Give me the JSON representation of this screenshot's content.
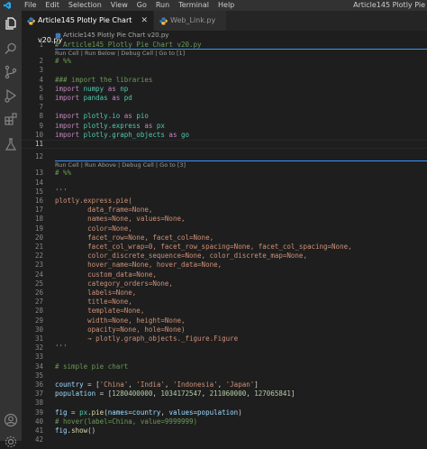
{
  "titlebar": {
    "menu": [
      "File",
      "Edit",
      "Selection",
      "View",
      "Go",
      "Run",
      "Terminal",
      "Help"
    ],
    "window_title": "Article145 Plotly Pie"
  },
  "tabs": [
    {
      "label": "Article145 Plotly Pie Chart v20.py",
      "active": true
    },
    {
      "label": "Web_Link.py",
      "active": false
    }
  ],
  "breadcrumb": "Article145 Plotly Pie Chart v20.py",
  "codelens": {
    "cell1": "Run Cell | Run Below | Debug Cell | Go to [1]",
    "cell3": "Run Cell | Run Above | Debug Cell | Go to [3]"
  },
  "colors": {
    "accent": "#3794ff",
    "comment": "#6a9955",
    "keyword": "#c586c0",
    "string": "#ce9178",
    "number": "#b5cea8"
  },
  "lines": [
    {
      "n": "1",
      "t": [
        [
          "c-com",
          "# Article145 Plotly Pie Chart v20.py"
        ]
      ]
    },
    {
      "n": "2",
      "t": [
        [
          "c-com",
          "# %%"
        ]
      ]
    },
    {
      "n": "3",
      "t": []
    },
    {
      "n": "4",
      "t": [
        [
          "c-com",
          "### import the libraries"
        ]
      ]
    },
    {
      "n": "5",
      "t": [
        [
          "c-kw",
          "import "
        ],
        [
          "c-mod",
          "numpy"
        ],
        [
          "c-kw",
          " as "
        ],
        [
          "c-mod",
          "np"
        ]
      ]
    },
    {
      "n": "6",
      "t": [
        [
          "c-kw",
          "import "
        ],
        [
          "c-mod",
          "pandas"
        ],
        [
          "c-kw",
          " as "
        ],
        [
          "c-mod",
          "pd"
        ]
      ]
    },
    {
      "n": "7",
      "t": []
    },
    {
      "n": "8",
      "t": [
        [
          "c-kw",
          "import "
        ],
        [
          "c-mod",
          "plotly.io"
        ],
        [
          "c-kw",
          " as "
        ],
        [
          "c-mod",
          "pio"
        ]
      ]
    },
    {
      "n": "9",
      "t": [
        [
          "c-kw",
          "import "
        ],
        [
          "c-mod",
          "plotly.express"
        ],
        [
          "c-kw",
          " as "
        ],
        [
          "c-mod",
          "px"
        ]
      ]
    },
    {
      "n": "10",
      "t": [
        [
          "c-kw",
          "import "
        ],
        [
          "c-mod",
          "plotly.graph_objects"
        ],
        [
          "c-kw",
          " as "
        ],
        [
          "c-mod",
          "go"
        ]
      ]
    },
    {
      "n": "11",
      "t": []
    },
    {
      "n": "12",
      "t": []
    },
    {
      "n": "13",
      "t": [
        [
          "c-com",
          "# %%"
        ]
      ]
    },
    {
      "n": "14",
      "t": []
    },
    {
      "n": "15",
      "t": [
        [
          "c-str",
          "'''"
        ]
      ]
    },
    {
      "n": "16",
      "t": [
        [
          "c-str",
          "plotly.express.pie("
        ]
      ]
    },
    {
      "n": "17",
      "t": [
        [
          "c-str",
          "        data_frame=None,"
        ]
      ]
    },
    {
      "n": "18",
      "t": [
        [
          "c-str",
          "        names=None, values=None,"
        ]
      ]
    },
    {
      "n": "19",
      "t": [
        [
          "c-str",
          "        color=None,"
        ]
      ]
    },
    {
      "n": "20",
      "t": [
        [
          "c-str",
          "        facet_row=None, facet_col=None,"
        ]
      ]
    },
    {
      "n": "21",
      "t": [
        [
          "c-str",
          "        facet_col_wrap=0, facet_row_spacing=None, facet_col_spacing=None,"
        ]
      ]
    },
    {
      "n": "22",
      "t": [
        [
          "c-str",
          "        color_discrete_sequence=None, color_discrete_map=None,"
        ]
      ]
    },
    {
      "n": "23",
      "t": [
        [
          "c-str",
          "        hover_name=None, hover_data=None,"
        ]
      ]
    },
    {
      "n": "24",
      "t": [
        [
          "c-str",
          "        custom_data=None,"
        ]
      ]
    },
    {
      "n": "25",
      "t": [
        [
          "c-str",
          "        category_orders=None,"
        ]
      ]
    },
    {
      "n": "26",
      "t": [
        [
          "c-str",
          "        labels=None,"
        ]
      ]
    },
    {
      "n": "27",
      "t": [
        [
          "c-str",
          "        title=None,"
        ]
      ]
    },
    {
      "n": "28",
      "t": [
        [
          "c-str",
          "        template=None,"
        ]
      ]
    },
    {
      "n": "29",
      "t": [
        [
          "c-str",
          "        width=None, height=None,"
        ]
      ]
    },
    {
      "n": "30",
      "t": [
        [
          "c-str",
          "        opacity=None, hole=None)"
        ]
      ]
    },
    {
      "n": "31",
      "t": [
        [
          "c-str",
          "        → plotly.graph_objects._figure.Figure"
        ]
      ]
    },
    {
      "n": "32",
      "t": [
        [
          "c-str",
          "'''"
        ]
      ]
    },
    {
      "n": "33",
      "t": []
    },
    {
      "n": "34",
      "t": [
        [
          "c-com",
          "# simple pie chart"
        ]
      ]
    },
    {
      "n": "35",
      "t": []
    },
    {
      "n": "36",
      "t": [
        [
          "c-id",
          "country"
        ],
        [
          "c-pl",
          " = ["
        ],
        [
          "c-str",
          "'China'"
        ],
        [
          "c-pl",
          ", "
        ],
        [
          "c-str",
          "'India'"
        ],
        [
          "c-pl",
          ", "
        ],
        [
          "c-str",
          "'Indonesia'"
        ],
        [
          "c-pl",
          ", "
        ],
        [
          "c-str",
          "'Japan'"
        ],
        [
          "c-pl",
          "]"
        ]
      ]
    },
    {
      "n": "37",
      "t": [
        [
          "c-id",
          "population"
        ],
        [
          "c-pl",
          " = ["
        ],
        [
          "c-num",
          "1280400000"
        ],
        [
          "c-pl",
          ", "
        ],
        [
          "c-num",
          "1034172547"
        ],
        [
          "c-pl",
          ", "
        ],
        [
          "c-num",
          "211060000"
        ],
        [
          "c-pl",
          ", "
        ],
        [
          "c-num",
          "127065841"
        ],
        [
          "c-pl",
          "]"
        ]
      ]
    },
    {
      "n": "38",
      "t": []
    },
    {
      "n": "39",
      "t": [
        [
          "c-id",
          "fig"
        ],
        [
          "c-pl",
          " = "
        ],
        [
          "c-mod",
          "px"
        ],
        [
          "c-pl",
          "."
        ],
        [
          "c-fn",
          "pie"
        ],
        [
          "c-pl",
          "("
        ],
        [
          "c-id",
          "names"
        ],
        [
          "c-pl",
          "="
        ],
        [
          "c-id",
          "country"
        ],
        [
          "c-pl",
          ", "
        ],
        [
          "c-id",
          "values"
        ],
        [
          "c-pl",
          "="
        ],
        [
          "c-id",
          "population"
        ],
        [
          "c-pl",
          ")"
        ]
      ]
    },
    {
      "n": "40",
      "t": [
        [
          "c-com",
          "# hover(label=China, value=9999999)"
        ]
      ]
    },
    {
      "n": "41",
      "t": [
        [
          "c-id",
          "fig"
        ],
        [
          "c-pl",
          "."
        ],
        [
          "c-fn",
          "show"
        ],
        [
          "c-pl",
          "()"
        ]
      ]
    },
    {
      "n": "42",
      "t": []
    }
  ]
}
